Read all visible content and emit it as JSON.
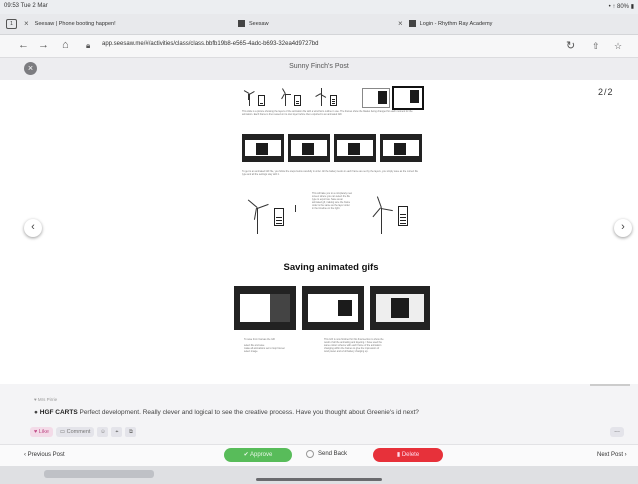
{
  "status_bar": {
    "time": "09:53  Tue 2 Mar",
    "right": "• ↑ 80% ▮"
  },
  "tabs": [
    {
      "label": "Seesaw | Phone booting happen!"
    },
    {
      "label": "Seesaw"
    },
    {
      "label": "Login - Rhythm Ray Academy"
    }
  ],
  "url_bar": {
    "url": "app.seesaw.me/#/activities/class/class.bbfb19b8-e565-4adc-b693-32ea4d9727bd"
  },
  "modal": {
    "title": "Sunny Finch's Post",
    "close_label": "×"
  },
  "post": {
    "page_counter": "2/2",
    "heading": "Saving animated gifs",
    "paragraphs": [
      "This slide is a picture showing the layers of the animation file with a wind farm outline in use. The frames show the blades being changed for each moment for the animation. Each frame is then saved on its own layer before then exported to an animated GIF.",
      "To get to an animated GIF file, you follow the steps below carefully in order. All the battery levels in each frame are set by the layers, you simply save as the correct file type and all the settings stay with it.",
      "This will take you to a completely new screen where you can select the file type to export as. Save as an animated gif, making sure the frame order is the same as the layer order in the timeline on the right.",
      "To save from Canvas the GIF",
      "select file and save",
      "make all animations set to loop forever",
      "select image.",
      "This GIF is now finished for this final section to show the result of all the animating and layering. I have used the same colour scheme with each frame of the animation changing within the frames to give the impression of wind power and a full battery charging up."
    ]
  },
  "comment": {
    "reactions": "♥ Mrs Pirrie",
    "author": "HGF CARTS",
    "text": "Perfect development. Really clever and logical to see the creative process. Have you thought about Greenie's id next?"
  },
  "actions": {
    "like": "♥ Like",
    "comment": "▭ Comment",
    "icon1": "☺",
    "icon2": "⌖",
    "icon3": "⧉",
    "more": "..."
  },
  "footer": {
    "previous": "‹  Previous Post",
    "approve": "✔  Approve",
    "send_back": "Send Back",
    "delete": "▮ Delete",
    "next": "Next Post  ›"
  },
  "nav": {
    "back": "←",
    "forward": "→",
    "home": "⌂",
    "reload": "↻",
    "prev_arrow": "‹",
    "next_arrow": "›"
  },
  "colors": {
    "approve": "#58bc5a",
    "delete": "#e7313a",
    "like": "#e05a9c"
  }
}
